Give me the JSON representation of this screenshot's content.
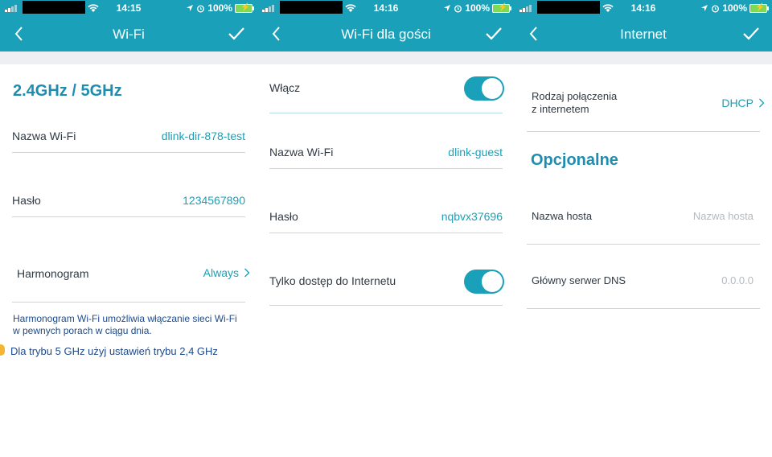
{
  "screens": [
    {
      "status": {
        "time": "14:15",
        "battery": "100%"
      },
      "nav": {
        "title": "Wi-Fi"
      },
      "section_title": "2.4GHz / 5GHz",
      "rows": [
        {
          "label": "Nazwa Wi-Fi",
          "value": "dlink-dir-878-test"
        },
        {
          "label": "Hasło",
          "value": "1234567890"
        },
        {
          "label": "Harmonogram",
          "value": "Always"
        }
      ],
      "note": "Harmonogram Wi-Fi umożliwia włączanie sieci Wi-Fi w pewnych porach w ciągu dnia.",
      "warning": "Dla trybu 5 GHz użyj ustawień trybu 2,4 GHz"
    },
    {
      "status": {
        "time": "14:16",
        "battery": "100%"
      },
      "nav": {
        "title": "Wi-Fi dla gości"
      },
      "rows": [
        {
          "label": "Włącz",
          "toggle_on": true
        },
        {
          "label": "Nazwa Wi-Fi",
          "value": "dlink-guest"
        },
        {
          "label": "Hasło",
          "value": "nqbvx37696"
        },
        {
          "label": "Tylko dostęp do Internetu",
          "toggle_on": true
        }
      ]
    },
    {
      "status": {
        "time": "14:16",
        "battery": "100%"
      },
      "nav": {
        "title": "Internet"
      },
      "rows": [
        {
          "label": "Rodzaj połączenia\nz internetem",
          "value": "DHCP"
        }
      ],
      "section_title": "Opcjonalne",
      "fields": [
        {
          "label": "Nazwa hosta",
          "placeholder": "Nazwa hosta"
        },
        {
          "label": "Główny serwer DNS",
          "placeholder": "0.0.0.0"
        }
      ]
    }
  ],
  "colors": {
    "accent": "#1aa0b8",
    "label": "#303a44",
    "divider": "#b8dde6",
    "band": "#eeeff3"
  }
}
